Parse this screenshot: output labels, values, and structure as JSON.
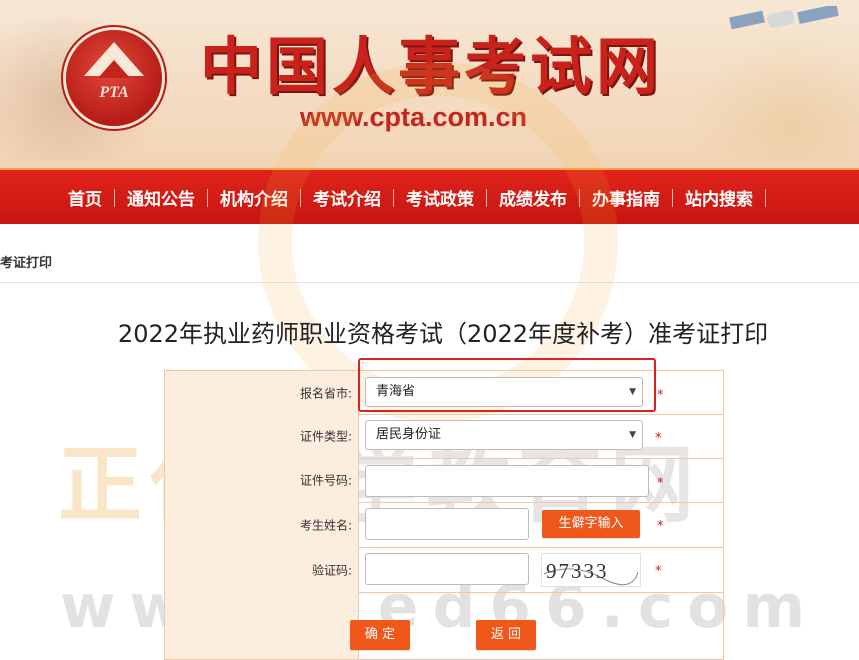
{
  "header": {
    "logo_text": "PTA",
    "site_title": "中国人事考试网",
    "site_url": "www.cpta.com.cn"
  },
  "nav": {
    "items": [
      "首页",
      "通知公告",
      "机构介绍",
      "考试介绍",
      "考试政策",
      "成绩发布",
      "办事指南",
      "站内搜索"
    ]
  },
  "breadcrumb": "考证打印",
  "page_title": "2022年执业药师职业资格考试（2022年度补考）准考证打印",
  "form": {
    "province": {
      "label": "报名省市:",
      "value": "青海省"
    },
    "id_type": {
      "label": "证件类型:",
      "value": "居民身份证"
    },
    "id_number": {
      "label": "证件号码:",
      "value": ""
    },
    "name": {
      "label": "考生姓名:",
      "value": "",
      "rare_char_button": "生僻字输入"
    },
    "captcha": {
      "label": "验证码:",
      "value": "",
      "image_text": "97333"
    },
    "required_mark": "*",
    "confirm_button": "确 定",
    "back_button": "返 回"
  },
  "watermark": {
    "line1_orange": "正保",
    "line1_gray": "医学教育网",
    "line2": "www.med66.com"
  },
  "colors": {
    "brand_red": "#c8221b",
    "nav_red": "#d81e17",
    "button_orange": "#f0571a",
    "label_bg": "#fbeede",
    "highlight_red": "#e0201c"
  }
}
